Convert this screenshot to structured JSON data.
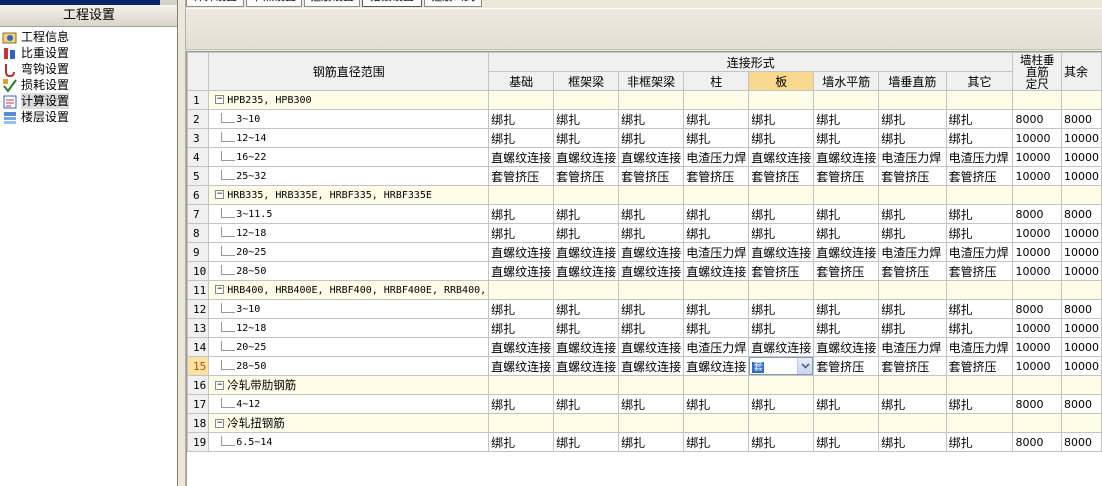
{
  "panel": {
    "title": "工程设置",
    "items": [
      {
        "label": "工程信息",
        "icon": "info-icon"
      },
      {
        "label": "比重设置",
        "icon": "weight-icon"
      },
      {
        "label": "弯钩设置",
        "icon": "hook-icon"
      },
      {
        "label": "损耗设置",
        "icon": "loss-icon"
      },
      {
        "label": "计算设置",
        "icon": "calc-icon",
        "selected": true
      },
      {
        "label": "楼层设置",
        "icon": "floor-icon"
      }
    ]
  },
  "tabs": [
    "计算设置",
    "节点设置",
    "箍筋设置",
    "搭接设置",
    "箍筋公式"
  ],
  "grid": {
    "col_header_a": "钢筋直径范围",
    "col_group": "连接形式",
    "sub_headers": [
      "基础",
      "框架梁",
      "非框架梁",
      "柱",
      "板",
      "墙水平筋",
      "墙垂直筋",
      "其它"
    ],
    "col_wall": "墙柱垂直筋\n定尺",
    "col_other": "其余"
  },
  "rows": [
    {
      "n": "1",
      "type": "group",
      "label": "HPB235, HPB300"
    },
    {
      "n": "2",
      "label": "3~10",
      "c": [
        "绑扎",
        "绑扎",
        "绑扎",
        "绑扎",
        "绑扎",
        "绑扎",
        "绑扎",
        "绑扎"
      ],
      "w": "8000",
      "o": "8000"
    },
    {
      "n": "3",
      "label": "12~14",
      "c": [
        "绑扎",
        "绑扎",
        "绑扎",
        "绑扎",
        "绑扎",
        "绑扎",
        "绑扎",
        "绑扎"
      ],
      "w": "10000",
      "o": "10000"
    },
    {
      "n": "4",
      "label": "16~22",
      "c": [
        "直螺纹连接",
        "直螺纹连接",
        "直螺纹连接",
        "电渣压力焊",
        "直螺纹连接",
        "直螺纹连接",
        "电渣压力焊",
        "电渣压力焊"
      ],
      "w": "10000",
      "o": "10000"
    },
    {
      "n": "5",
      "label": "25~32",
      "c": [
        "套管挤压",
        "套管挤压",
        "套管挤压",
        "套管挤压",
        "套管挤压",
        "套管挤压",
        "套管挤压",
        "套管挤压"
      ],
      "w": "10000",
      "o": "10000"
    },
    {
      "n": "6",
      "type": "group",
      "label": "HRB335, HRB335E, HRBF335, HRBF335E"
    },
    {
      "n": "7",
      "label": "3~11.5",
      "c": [
        "绑扎",
        "绑扎",
        "绑扎",
        "绑扎",
        "绑扎",
        "绑扎",
        "绑扎",
        "绑扎"
      ],
      "w": "8000",
      "o": "8000"
    },
    {
      "n": "8",
      "label": "12~18",
      "c": [
        "绑扎",
        "绑扎",
        "绑扎",
        "绑扎",
        "绑扎",
        "绑扎",
        "绑扎",
        "绑扎"
      ],
      "w": "10000",
      "o": "10000"
    },
    {
      "n": "9",
      "label": "20~25",
      "c": [
        "直螺纹连接",
        "直螺纹连接",
        "直螺纹连接",
        "电渣压力焊",
        "直螺纹连接",
        "直螺纹连接",
        "电渣压力焊",
        "电渣压力焊"
      ],
      "w": "10000",
      "o": "10000"
    },
    {
      "n": "10",
      "label": "28~50",
      "c": [
        "直螺纹连接",
        "直螺纹连接",
        "直螺纹连接",
        "直螺纹连接",
        "套管挤压",
        "套管挤压",
        "套管挤压",
        "套管挤压"
      ],
      "w": "10000",
      "o": "10000"
    },
    {
      "n": "11",
      "type": "group",
      "label": "HRB400, HRB400E, HRBF400, HRBF400E, RRB400,"
    },
    {
      "n": "12",
      "label": "3~10",
      "c": [
        "绑扎",
        "绑扎",
        "绑扎",
        "绑扎",
        "绑扎",
        "绑扎",
        "绑扎",
        "绑扎"
      ],
      "w": "8000",
      "o": "8000"
    },
    {
      "n": "13",
      "label": "12~18",
      "c": [
        "绑扎",
        "绑扎",
        "绑扎",
        "绑扎",
        "绑扎",
        "绑扎",
        "绑扎",
        "绑扎"
      ],
      "w": "10000",
      "o": "10000"
    },
    {
      "n": "14",
      "label": "20~25",
      "c": [
        "直螺纹连接",
        "直螺纹连接",
        "直螺纹连接",
        "电渣压力焊",
        "直螺纹连接",
        "直螺纹连接",
        "电渣压力焊",
        "电渣压力焊"
      ],
      "w": "10000",
      "o": "10000"
    },
    {
      "n": "15",
      "label": "28~50",
      "current": true,
      "c": [
        "直螺纹连接",
        "直螺纹连接",
        "直螺纹连接",
        "直螺纹连接",
        "套管挤压",
        "套管挤压",
        "套管挤压",
        "套管挤压"
      ],
      "w": "10000",
      "o": "10000",
      "combo": "套"
    },
    {
      "n": "16",
      "type": "group",
      "label": "冷轧带肋钢筋",
      "cn": true
    },
    {
      "n": "17",
      "label": "4~12",
      "c": [
        "绑扎",
        "绑扎",
        "绑扎",
        "绑扎",
        "绑扎",
        "绑扎",
        "绑扎",
        "绑扎"
      ],
      "w": "8000",
      "o": "8000"
    },
    {
      "n": "18",
      "type": "group",
      "label": "冷轧扭钢筋",
      "cn": true
    },
    {
      "n": "19",
      "label": "6.5~14",
      "c": [
        "绑扎",
        "绑扎",
        "绑扎",
        "绑扎",
        "绑扎",
        "绑扎",
        "绑扎",
        "绑扎"
      ],
      "w": "8000",
      "o": "8000"
    }
  ],
  "colors": {
    "current_row": "#fbe3a3",
    "highlight_header": "#f9d890",
    "group_row": "#fffde8"
  }
}
